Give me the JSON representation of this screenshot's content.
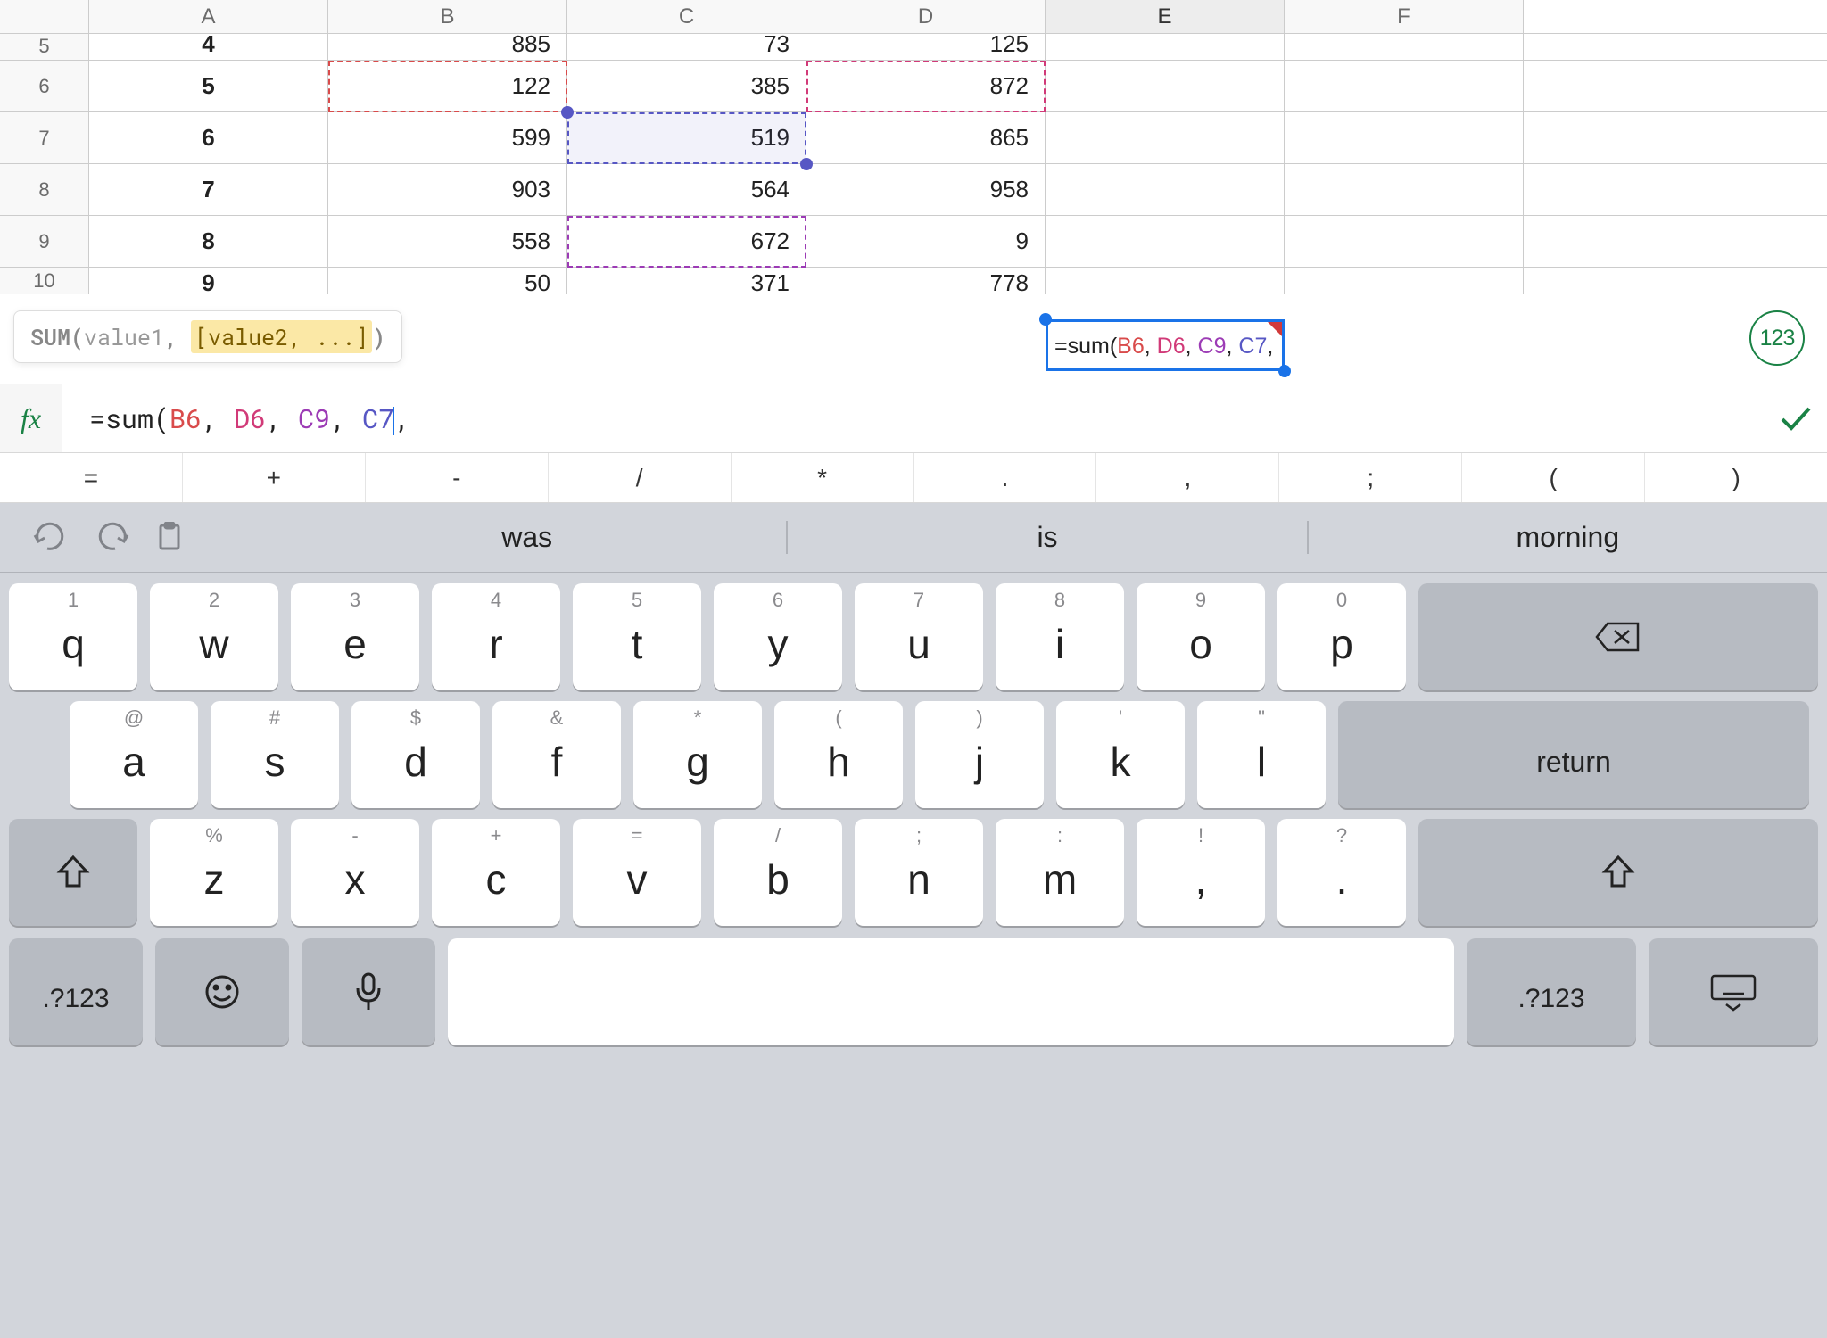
{
  "columns": [
    "A",
    "B",
    "C",
    "D",
    "E",
    "F"
  ],
  "active_column": "E",
  "rows_visible": [
    {
      "num": "5",
      "label": "4",
      "B": "885",
      "C": "73",
      "D": "125",
      "partial": "top"
    },
    {
      "num": "6",
      "label": "5",
      "B": "122",
      "C": "385",
      "D": "872"
    },
    {
      "num": "7",
      "label": "6",
      "B": "599",
      "C": "519",
      "D": "865"
    },
    {
      "num": "8",
      "label": "7",
      "B": "903",
      "C": "564",
      "D": "958"
    },
    {
      "num": "9",
      "label": "8",
      "B": "558",
      "C": "672",
      "D": "9"
    },
    {
      "num": "10",
      "label": "9",
      "B": "50",
      "C": "371",
      "D": "778",
      "partial": "bottom"
    }
  ],
  "highlights": {
    "B6": {
      "color": "red"
    },
    "D6": {
      "color": "pink"
    },
    "C7": {
      "color": "blue"
    },
    "C9": {
      "color": "purple"
    }
  },
  "active_cell": "E11",
  "tooltip": {
    "fn": "SUM",
    "arg1": "value1",
    "arg2_text": "[value2, ...]"
  },
  "num_badge": "123",
  "cell_formula_prefix": "=sum(",
  "cell_formula_refs": [
    "B6",
    "D6",
    "C9",
    "C7"
  ],
  "formula_bar_prefix": "=sum(",
  "formula_bar_refs": [
    "B6",
    "D6",
    "C9",
    "C7"
  ],
  "operators": [
    "=",
    "+",
    "-",
    "/",
    "*",
    ".",
    ",",
    ";",
    "(",
    ")"
  ],
  "suggestions": [
    "was",
    "is",
    "morning"
  ],
  "keyboard": {
    "row1": [
      {
        "sec": "1",
        "main": "q"
      },
      {
        "sec": "2",
        "main": "w"
      },
      {
        "sec": "3",
        "main": "e"
      },
      {
        "sec": "4",
        "main": "r"
      },
      {
        "sec": "5",
        "main": "t"
      },
      {
        "sec": "6",
        "main": "y"
      },
      {
        "sec": "7",
        "main": "u"
      },
      {
        "sec": "8",
        "main": "i"
      },
      {
        "sec": "9",
        "main": "o"
      },
      {
        "sec": "0",
        "main": "p"
      }
    ],
    "row2": [
      {
        "sec": "@",
        "main": "a"
      },
      {
        "sec": "#",
        "main": "s"
      },
      {
        "sec": "$",
        "main": "d"
      },
      {
        "sec": "&",
        "main": "f"
      },
      {
        "sec": "*",
        "main": "g"
      },
      {
        "sec": "(",
        "main": "h"
      },
      {
        "sec": ")",
        "main": "j"
      },
      {
        "sec": "'",
        "main": "k"
      },
      {
        "sec": "\"",
        "main": "l"
      }
    ],
    "row3": [
      {
        "sec": "%",
        "main": "z"
      },
      {
        "sec": "-",
        "main": "x"
      },
      {
        "sec": "+",
        "main": "c"
      },
      {
        "sec": "=",
        "main": "v"
      },
      {
        "sec": "/",
        "main": "b"
      },
      {
        "sec": ";",
        "main": "n"
      },
      {
        "sec": ":",
        "main": "m"
      },
      {
        "sec": "!",
        "main": ","
      },
      {
        "sec": "?",
        "main": "."
      }
    ],
    "numswitch": ".?123",
    "return_label": "return"
  }
}
